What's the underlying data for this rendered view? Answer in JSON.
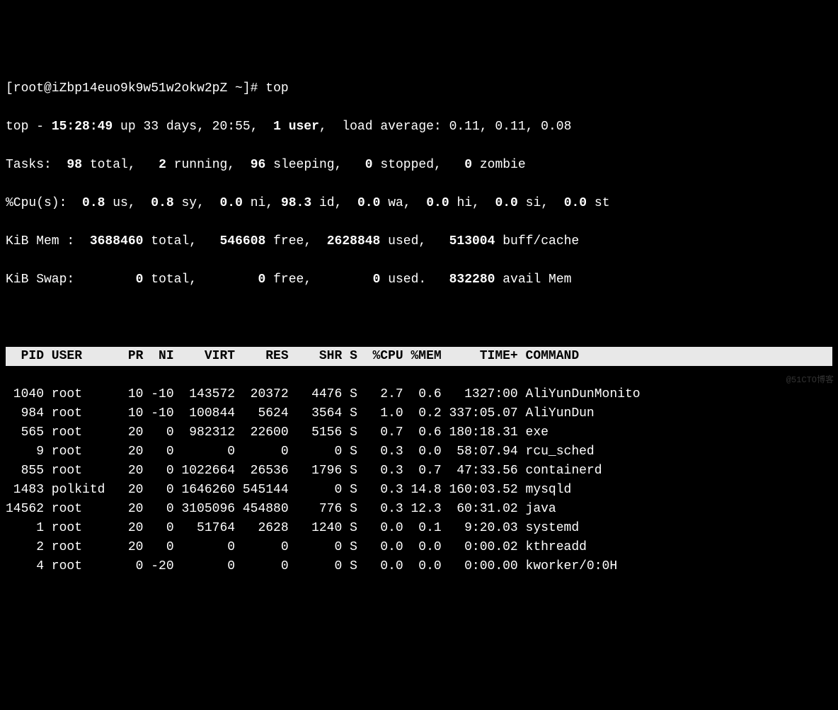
{
  "prompt": "[root@iZbp14euo9k9w51w2okw2pZ ~]# ",
  "command": "top",
  "summary": {
    "program": "top",
    "time": "15:28:49",
    "uptime": "up 33 days, 20:55",
    "users": "1 user",
    "load_label": "load average:",
    "load_avg": "0.11, 0.11, 0.08"
  },
  "tasks": {
    "label": "Tasks:",
    "total": "98",
    "total_label": "total,",
    "running": "2",
    "running_label": "running,",
    "sleeping": "96",
    "sleeping_label": "sleeping,",
    "stopped": "0",
    "stopped_label": "stopped,",
    "zombie": "0",
    "zombie_label": "zombie"
  },
  "cpu": {
    "label": "%Cpu(s):",
    "us": "0.8",
    "us_label": "us,",
    "sy": "0.8",
    "sy_label": "sy,",
    "ni": "0.0",
    "ni_label": "ni,",
    "id": "98.3",
    "id_label": "id,",
    "wa": "0.0",
    "wa_label": "wa,",
    "hi": "0.0",
    "hi_label": "hi,",
    "si": "0.0",
    "si_label": "si,",
    "st": "0.0",
    "st_label": "st"
  },
  "mem": {
    "label": "KiB Mem :",
    "total": "3688460",
    "total_label": "total,",
    "free": "546608",
    "free_label": "free,",
    "used": "2628848",
    "used_label": "used,",
    "buff": "513004",
    "buff_label": "buff/cache"
  },
  "swap": {
    "label": "KiB Swap:",
    "total": "0",
    "total_label": "total,",
    "free": "0",
    "free_label": "free,",
    "used": "0",
    "used_label": "used.",
    "avail": "832280",
    "avail_label": "avail Mem"
  },
  "columns": {
    "pid": "PID",
    "user": "USER",
    "pr": "PR",
    "ni": "NI",
    "virt": "VIRT",
    "res": "RES",
    "shr": "SHR",
    "s": "S",
    "cpu": "%CPU",
    "mem": "%MEM",
    "time": "TIME+",
    "command": "COMMAND"
  },
  "processes": [
    {
      "pid": "1040",
      "user": "root",
      "pr": "10",
      "ni": "-10",
      "virt": "143572",
      "res": "20372",
      "shr": "4476",
      "s": "S",
      "cpu": "2.7",
      "mem": "0.6",
      "time": "1327:00",
      "command": "AliYunDunMonito"
    },
    {
      "pid": "984",
      "user": "root",
      "pr": "10",
      "ni": "-10",
      "virt": "100844",
      "res": "5624",
      "shr": "3564",
      "s": "S",
      "cpu": "1.0",
      "mem": "0.2",
      "time": "337:05.07",
      "command": "AliYunDun"
    },
    {
      "pid": "565",
      "user": "root",
      "pr": "20",
      "ni": "0",
      "virt": "982312",
      "res": "22600",
      "shr": "5156",
      "s": "S",
      "cpu": "0.7",
      "mem": "0.6",
      "time": "180:18.31",
      "command": "exe"
    },
    {
      "pid": "9",
      "user": "root",
      "pr": "20",
      "ni": "0",
      "virt": "0",
      "res": "0",
      "shr": "0",
      "s": "S",
      "cpu": "0.3",
      "mem": "0.0",
      "time": "58:07.94",
      "command": "rcu_sched"
    },
    {
      "pid": "855",
      "user": "root",
      "pr": "20",
      "ni": "0",
      "virt": "1022664",
      "res": "26536",
      "shr": "1796",
      "s": "S",
      "cpu": "0.3",
      "mem": "0.7",
      "time": "47:33.56",
      "command": "containerd"
    },
    {
      "pid": "1483",
      "user": "polkitd",
      "pr": "20",
      "ni": "0",
      "virt": "1646260",
      "res": "545144",
      "shr": "0",
      "s": "S",
      "cpu": "0.3",
      "mem": "14.8",
      "time": "160:03.52",
      "command": "mysqld"
    },
    {
      "pid": "14562",
      "user": "root",
      "pr": "20",
      "ni": "0",
      "virt": "3105096",
      "res": "454880",
      "shr": "776",
      "s": "S",
      "cpu": "0.3",
      "mem": "12.3",
      "time": "60:31.02",
      "command": "java"
    },
    {
      "pid": "1",
      "user": "root",
      "pr": "20",
      "ni": "0",
      "virt": "51764",
      "res": "2628",
      "shr": "1240",
      "s": "S",
      "cpu": "0.0",
      "mem": "0.1",
      "time": "9:20.03",
      "command": "systemd"
    },
    {
      "pid": "2",
      "user": "root",
      "pr": "20",
      "ni": "0",
      "virt": "0",
      "res": "0",
      "shr": "0",
      "s": "S",
      "cpu": "0.0",
      "mem": "0.0",
      "time": "0:00.02",
      "command": "kthreadd"
    },
    {
      "pid": "4",
      "user": "root",
      "pr": "0",
      "ni": "-20",
      "virt": "0",
      "res": "0",
      "shr": "0",
      "s": "S",
      "cpu": "0.0",
      "mem": "0.0",
      "time": "0:00.00",
      "command": "kworker/0:0H"
    }
  ],
  "watermark": "@51CTO博客"
}
